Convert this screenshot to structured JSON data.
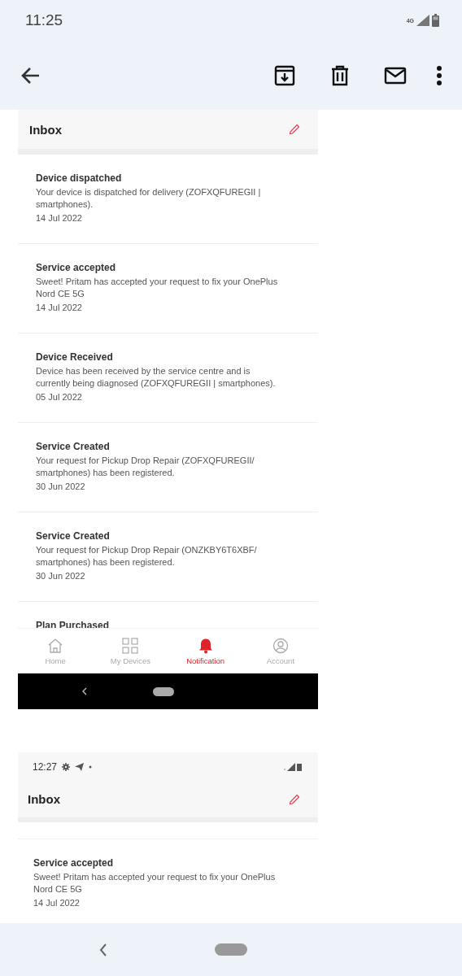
{
  "status_bar": {
    "time": "11:25",
    "network": "4G"
  },
  "screenshots": [
    {
      "header": {
        "title": "Inbox"
      },
      "notifications": [
        {
          "title": "Device dispatched",
          "body": "Your device is dispatched for delivery (ZOFXQFUREGII | smartphones).",
          "date": "14 Jul 2022"
        },
        {
          "title": "Service accepted",
          "body": "Sweet! Pritam has accepted your request to fix your OnePlus Nord CE 5G",
          "date": "14 Jul 2022"
        },
        {
          "title": "Device Received",
          "body": "Device has been received by the service centre and is currently being diagnosed (ZOFXQFUREGII | smartphones).",
          "date": "05 Jul 2022"
        },
        {
          "title": "Service Created",
          "body": "Your request for Pickup Drop Repair (ZOFXQFUREGII/ smartphones) has been registered.",
          "date": "30 Jun 2022"
        },
        {
          "title": "Service Created",
          "body": "Your request for Pickup Drop Repair (ONZKBY6T6XBF/ smartphones) has been registered.",
          "date": "30 Jun 2022"
        },
        {
          "title": "Plan Purchased"
        }
      ],
      "bottom_nav": [
        {
          "label": "Home",
          "selected": false
        },
        {
          "label": "My Devices",
          "selected": false
        },
        {
          "label": "Notification",
          "selected": true
        },
        {
          "label": "Account",
          "selected": false
        }
      ],
      "system_nav": true
    },
    {
      "status_bar": {
        "time": "12:27"
      },
      "header": {
        "title": "Inbox"
      },
      "notifications": [
        {
          "title": "Service accepted",
          "body": "Sweet! Pritam has accepted your request to fix your OnePlus Nord CE 5G",
          "date": "14 Jul 2022"
        }
      ]
    }
  ]
}
